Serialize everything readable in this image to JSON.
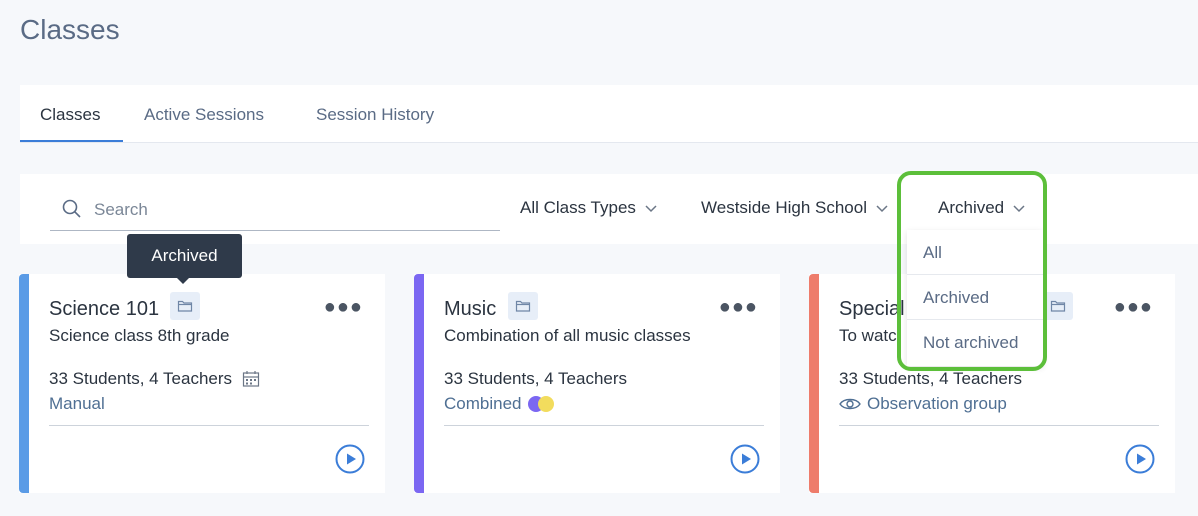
{
  "page": {
    "title": "Classes"
  },
  "tabs": [
    {
      "label": "Classes",
      "active": true
    },
    {
      "label": "Active Sessions",
      "active": false
    },
    {
      "label": "Session History",
      "active": false
    }
  ],
  "filters": {
    "search_placeholder": "Search",
    "class_types": "All Class Types",
    "school": "Westside High School",
    "archived": "Archived"
  },
  "archived_dropdown": {
    "options": [
      "All",
      "Archived",
      "Not archived"
    ]
  },
  "tooltip": {
    "text": "Archived"
  },
  "cards": [
    {
      "name": "Science 101",
      "description": "Science class 8th grade",
      "counts": "33 Students, 4 Teachers",
      "type": "Manual",
      "stripe_color": "#5a9be6",
      "type_icon": "calendar-icon"
    },
    {
      "name": "Music",
      "description": "Combination of all music classes",
      "counts": "33 Students, 4 Teachers",
      "type": "Combined",
      "stripe_color": "#7b67f2",
      "type_icon": "combined-dots-icon"
    },
    {
      "name": "Special",
      "description": "To watc",
      "counts": "33 Students, 4 Teachers",
      "type": "Observation group",
      "stripe_color": "#ee7c6b",
      "type_icon": "eye-icon"
    }
  ],
  "colors": {
    "accent": "#3b7dd8",
    "highlight": "#5cbf3a",
    "tooltip_bg": "#2f3a4a"
  }
}
